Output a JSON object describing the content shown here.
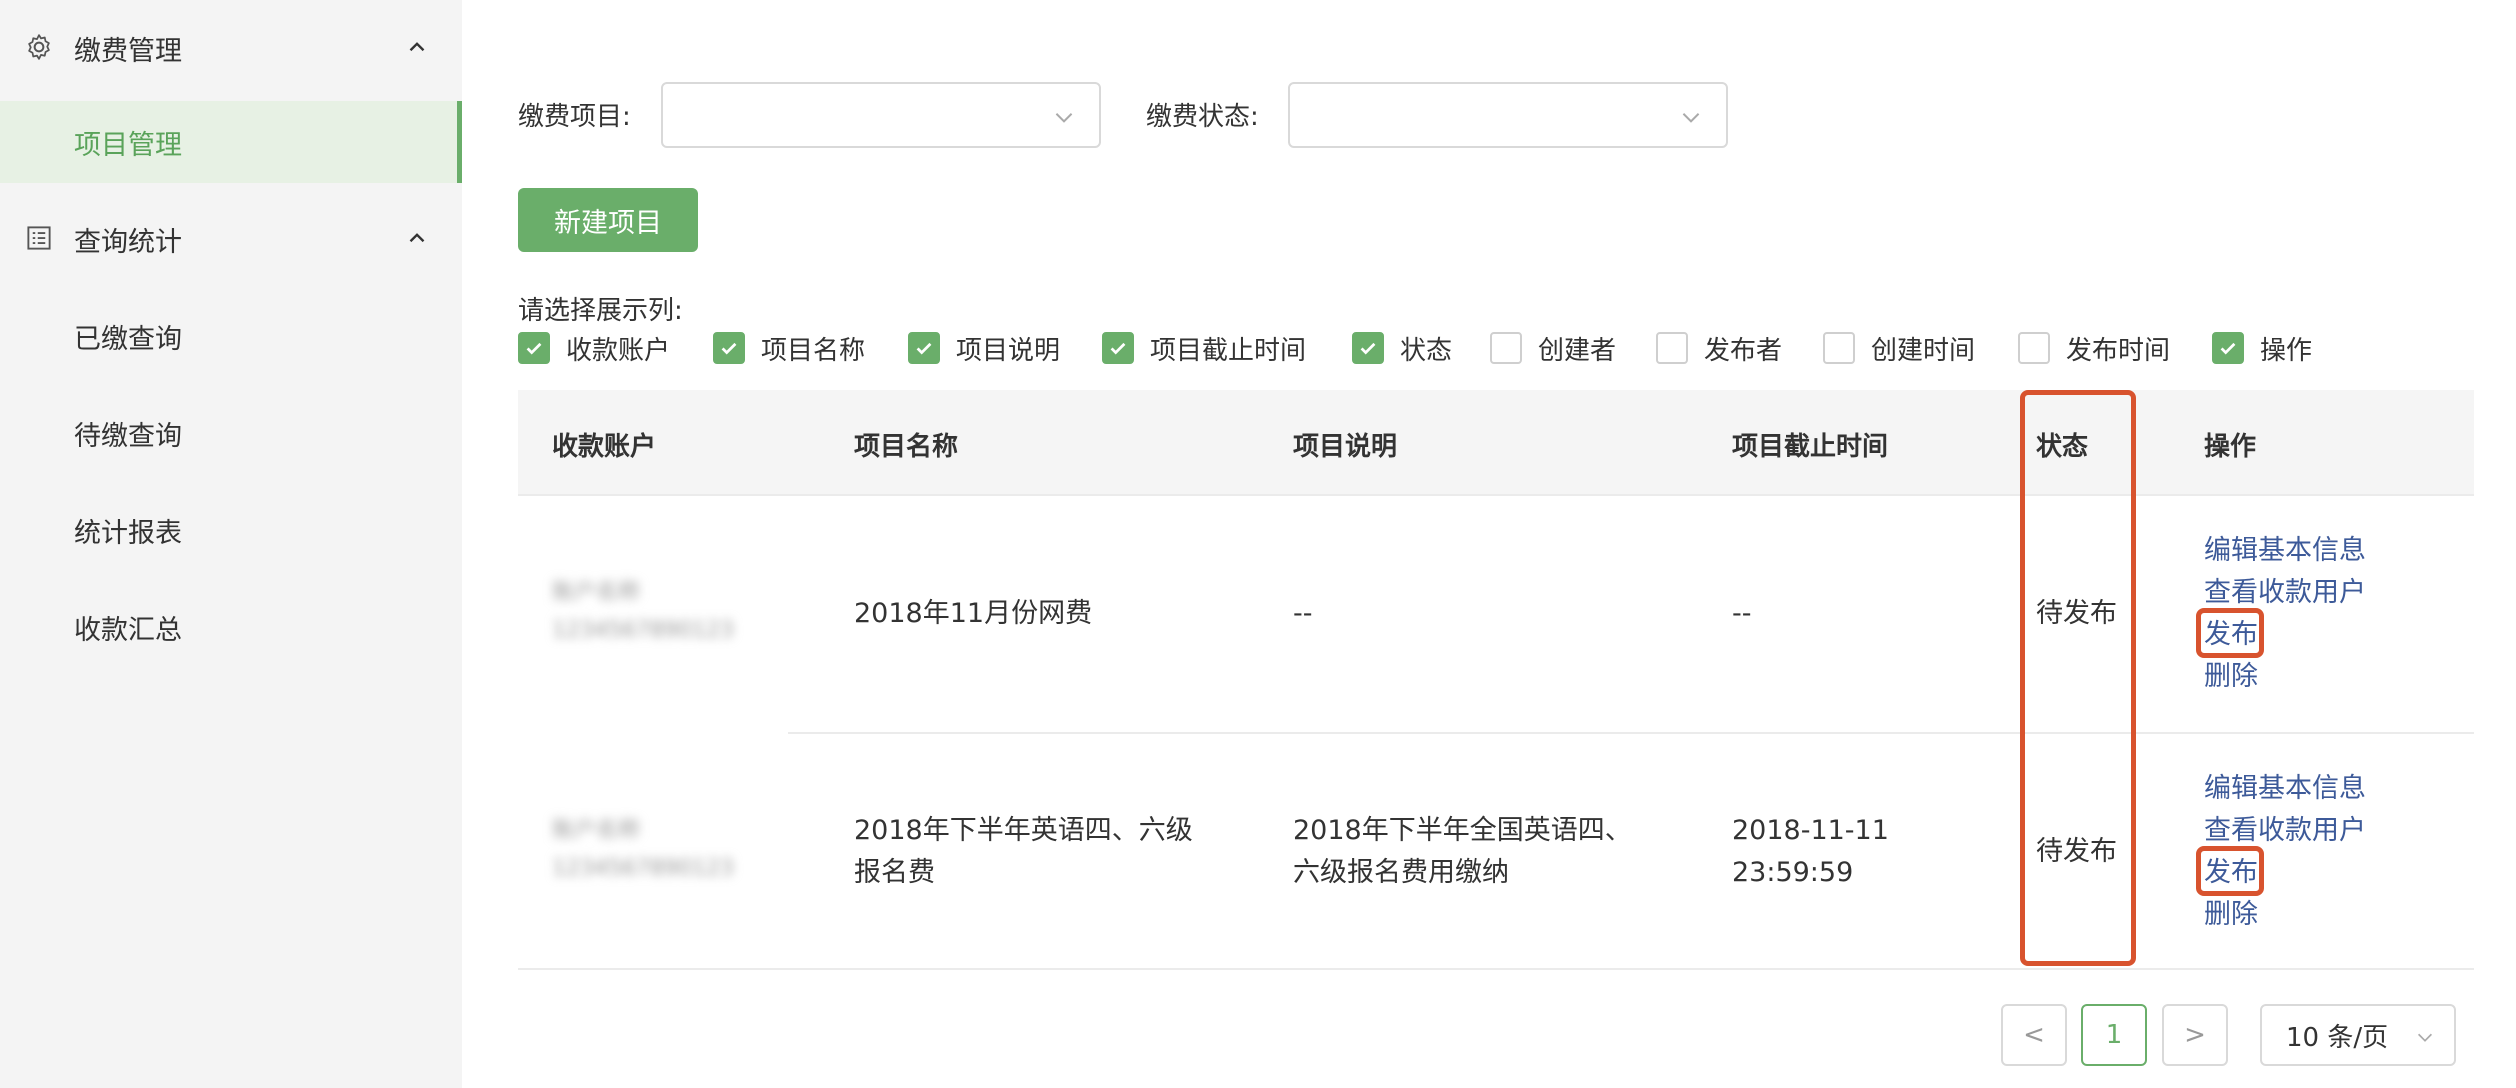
{
  "sidebar": {
    "group1": {
      "label": "缴费管理",
      "icon": "gear-icon"
    },
    "item_project": "项目管理",
    "group2": {
      "label": "查询统计",
      "icon": "list-icon"
    },
    "items": [
      "已缴查询",
      "待缴查询",
      "统计报表",
      "收款汇总"
    ]
  },
  "filters": {
    "project_label": "缴费项目:",
    "status_label": "缴费状态:",
    "project_value": "",
    "status_value": ""
  },
  "new_button": "新建项目",
  "columns_label": "请选择展示列:",
  "column_options": [
    {
      "label": "收款账户",
      "checked": true
    },
    {
      "label": "项目名称",
      "checked": true
    },
    {
      "label": "项目说明",
      "checked": true
    },
    {
      "label": "项目截止时间",
      "checked": true
    },
    {
      "label": "状态",
      "checked": true
    },
    {
      "label": "创建者",
      "checked": false
    },
    {
      "label": "发布者",
      "checked": false
    },
    {
      "label": "创建时间",
      "checked": false
    },
    {
      "label": "发布时间",
      "checked": false
    },
    {
      "label": "操作",
      "checked": true
    }
  ],
  "table": {
    "headers": [
      "收款账户",
      "项目名称",
      "项目说明",
      "项目截止时间",
      "状态",
      "操作"
    ],
    "rows": [
      {
        "account_blurred": [
          "账户名称",
          "1234567890123"
        ],
        "name": [
          "2018年11月份网费"
        ],
        "desc": [
          "--"
        ],
        "deadline": [
          "--"
        ],
        "status": "待发布"
      },
      {
        "account_blurred": [
          "账户名称",
          "1234567890123"
        ],
        "name": [
          "2018年下半年英语四、六级",
          "报名费"
        ],
        "desc": [
          "2018年下半年全国英语四、",
          "六级报名费用缴纳"
        ],
        "deadline": [
          "2018-11-11",
          "23:59:59"
        ],
        "status": "待发布"
      }
    ],
    "actions": [
      "编辑基本信息",
      "查看收款用户",
      "发布",
      "删除"
    ]
  },
  "pagination": {
    "prev": "<",
    "current": "1",
    "next": ">",
    "page_size": "10 条/页"
  },
  "colors": {
    "accent": "#6aae6a",
    "link": "#3d5a99",
    "highlight": "#d8532e"
  }
}
